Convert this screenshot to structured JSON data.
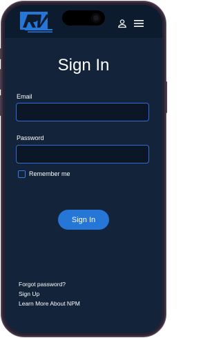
{
  "header": {
    "logo": "rv-logo",
    "user_icon": "user-icon",
    "menu_icon": "hamburger-menu-icon"
  },
  "main": {
    "title": "Sign In",
    "email_label": "Email",
    "email_value": "",
    "password_label": "Password",
    "password_value": "",
    "remember_label": "Remember me",
    "remember_checked": false,
    "signin_label": "Sign In"
  },
  "links": {
    "forgot": "Forgot password?",
    "signup": "Sign Up",
    "learn_more": "Learn More About NPM"
  },
  "colors": {
    "background": "#12233a",
    "header": "#0d1b2e",
    "accent": "#2676d8",
    "input_border": "#2d6fd6",
    "text": "#ffffff"
  }
}
